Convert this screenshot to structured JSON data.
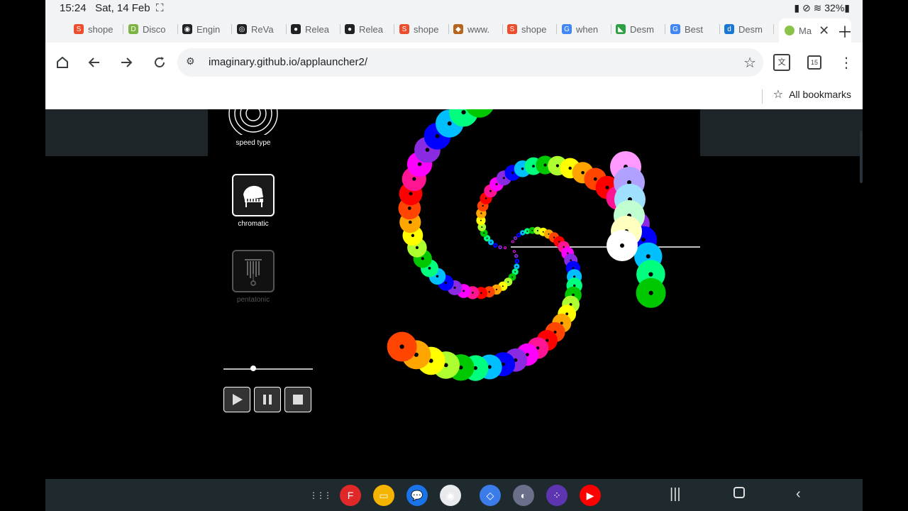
{
  "status": {
    "time": "15:24",
    "date": "Sat, 14 Feb",
    "battery": "32%"
  },
  "tabs": [
    {
      "label": "shope",
      "color": "#ee4d2d",
      "glyph": "S"
    },
    {
      "label": "Disco",
      "color": "#7cb342",
      "glyph": "D"
    },
    {
      "label": "Engin",
      "color": "#202124",
      "glyph": "◉"
    },
    {
      "label": "ReVa",
      "color": "#202124",
      "glyph": "◎"
    },
    {
      "label": "Relea",
      "color": "#202124",
      "glyph": "●"
    },
    {
      "label": "Relea",
      "color": "#202124",
      "glyph": "●"
    },
    {
      "label": "shope",
      "color": "#ee4d2d",
      "glyph": "S"
    },
    {
      "label": "www.",
      "color": "#b5651d",
      "glyph": "◆"
    },
    {
      "label": "shope",
      "color": "#ee4d2d",
      "glyph": "S"
    },
    {
      "label": "when",
      "color": "#4285f4",
      "glyph": "G"
    },
    {
      "label": "Desm",
      "color": "#2f9e44",
      "glyph": "◣"
    },
    {
      "label": "Best",
      "color": "#4285f4",
      "glyph": "G"
    },
    {
      "label": "Desm",
      "color": "#1976d2",
      "glyph": "d"
    }
  ],
  "active_tab": {
    "label": "Ma",
    "color": "#8bc34a"
  },
  "toolbar": {
    "url": "imaginary.github.io/applauncher2/",
    "tab_count": "15"
  },
  "bookmarks": {
    "all_label": "All bookmarks"
  },
  "app": {
    "modes": [
      {
        "label": "speed type",
        "enabled": true
      },
      {
        "label": "chromatic",
        "enabled": true
      },
      {
        "label": "pentatonic",
        "enabled": false
      }
    ],
    "tempo_level": 0.33
  },
  "dock": {
    "apps": [
      {
        "name": "apps-grid-icon",
        "color": "transparent",
        "glyph": "⋮⋮⋮"
      },
      {
        "name": "flipboard-icon",
        "color": "#e12828",
        "glyph": "F"
      },
      {
        "name": "files-icon",
        "color": "#f5b400",
        "glyph": "▭"
      },
      {
        "name": "messages-icon",
        "color": "#1a73e8",
        "glyph": "💬"
      },
      {
        "name": "chrome-icon",
        "color": "#e8eaed",
        "glyph": "◉"
      },
      {
        "name": "roblox-icon",
        "color": "#3b7bea",
        "glyph": "◇"
      },
      {
        "name": "game-icon",
        "color": "#6b6f8a",
        "glyph": "◐"
      },
      {
        "name": "app-library-icon",
        "color": "#5e35b1",
        "glyph": "⁘"
      },
      {
        "name": "youtube-icon",
        "color": "#ff0000",
        "glyph": "▶"
      }
    ]
  }
}
